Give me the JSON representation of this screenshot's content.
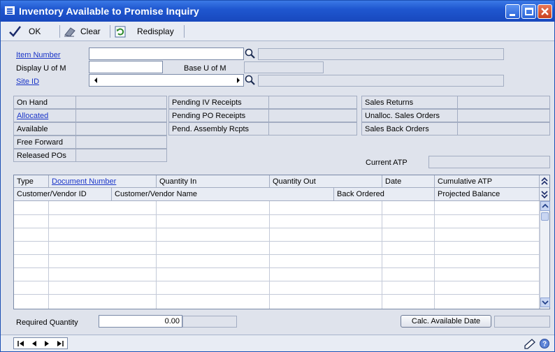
{
  "window": {
    "title": "Inventory Available to Promise Inquiry"
  },
  "toolbar": {
    "ok_label": "OK",
    "clear_label": "Clear",
    "redisplay_label": "Redisplay"
  },
  "header": {
    "item_number_label": "Item Number",
    "item_number_value": "",
    "display_uofm_label": "Display U of M",
    "display_uofm_value": "",
    "base_uofm_label": "Base U of M",
    "base_uofm_value": "",
    "site_id_label": "Site ID",
    "site_id_value": ""
  },
  "quantities": {
    "left": [
      {
        "label": "On Hand",
        "link": false,
        "value": ""
      },
      {
        "label": "Allocated",
        "link": true,
        "value": ""
      },
      {
        "label": "Available",
        "link": false,
        "value": ""
      },
      {
        "label": "Free Forward",
        "link": false,
        "value": ""
      },
      {
        "label": "Released POs",
        "link": false,
        "value": ""
      }
    ],
    "middle": [
      {
        "label": "Pending IV Receipts",
        "value": ""
      },
      {
        "label": "Pending PO Receipts",
        "value": ""
      },
      {
        "label": "Pend. Assembly Rcpts",
        "value": ""
      }
    ],
    "right": [
      {
        "label": "Sales Returns",
        "value": ""
      },
      {
        "label": "Unalloc. Sales Orders",
        "value": ""
      },
      {
        "label": "Sales Back Orders",
        "value": ""
      }
    ],
    "current_atp_label": "Current ATP",
    "current_atp_value": ""
  },
  "grid": {
    "header_row1": [
      "Type",
      "Document Number",
      "Quantity In",
      "Quantity Out",
      "Date",
      "Cumulative ATP"
    ],
    "header_row2": [
      "Customer/Vendor ID",
      "Customer/Vendor Name",
      "Back Ordered",
      "Projected Balance"
    ],
    "expand_icon": "double-chevron-up-icon",
    "collapse_icon": "double-chevron-down-icon"
  },
  "footer": {
    "required_quantity_label": "Required Quantity",
    "required_quantity_value": "0.00",
    "calc_button_label": "Calc. Available Date",
    "available_date_value": ""
  },
  "colors": {
    "titlebar": "#1f57d0",
    "window_bg": "#dfe3ec",
    "link": "#1a35c8"
  }
}
